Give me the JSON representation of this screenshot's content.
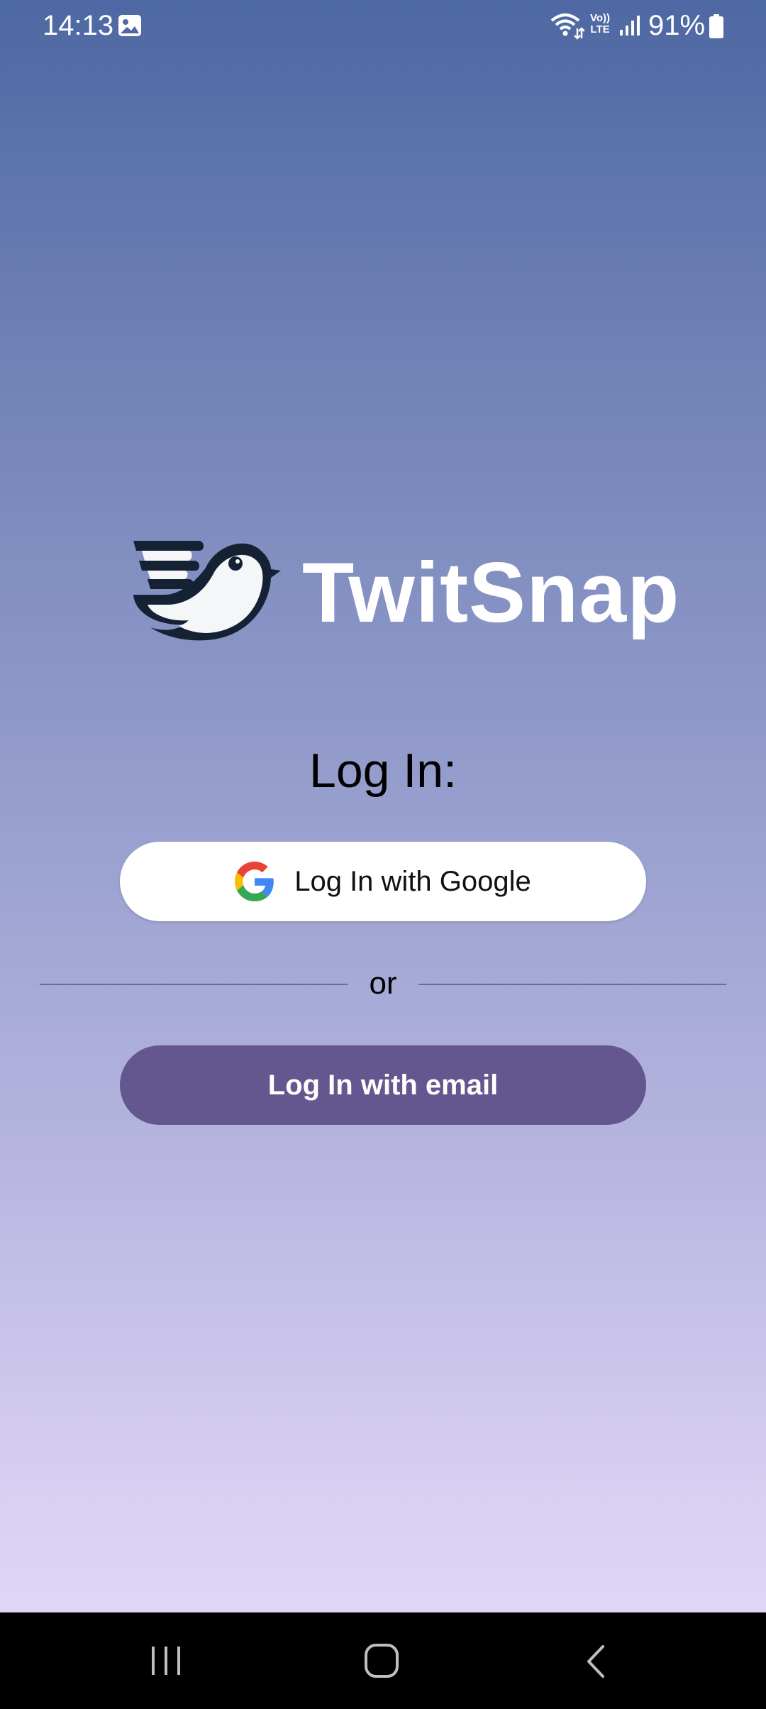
{
  "status_bar": {
    "time": "14:13",
    "battery": "91%",
    "network": "Vo)) LTE",
    "icons": [
      "gallery-icon",
      "wifi-icon",
      "volte-icon",
      "signal-icon",
      "battery-icon"
    ]
  },
  "app": {
    "name": "TwitSnap",
    "logo_icon": "bird-logo-icon"
  },
  "login": {
    "heading": "Log In:",
    "google_button_label": "Log In with Google",
    "google_icon": "google-g-icon",
    "divider_text": "or",
    "email_button_label": "Log In with email"
  },
  "colors": {
    "gradient_top": "#4e68a3",
    "gradient_bottom": "#e6dcfb",
    "email_button": "#64568f",
    "google_button": "#ffffff"
  },
  "nav_bar": {
    "icons": [
      "recents-icon",
      "home-icon",
      "back-icon"
    ]
  }
}
